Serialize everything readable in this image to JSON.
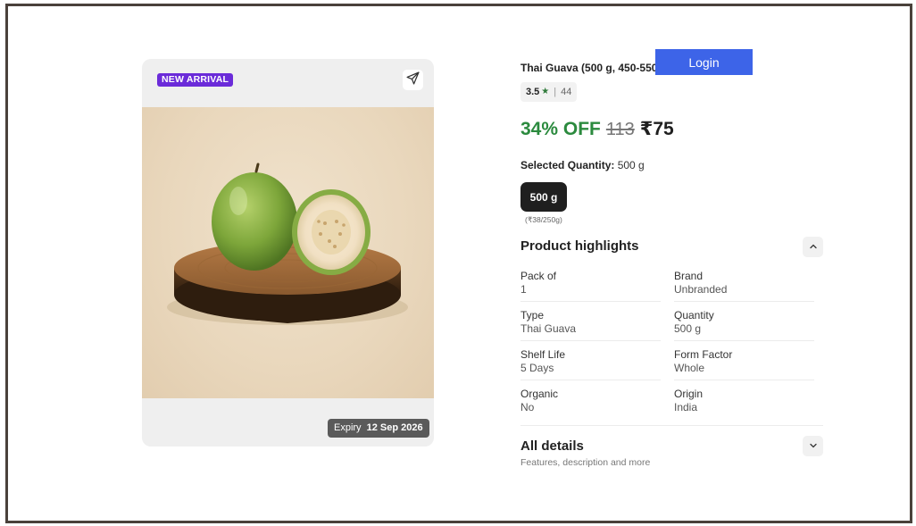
{
  "media": {
    "badge": "NEW ARRIVAL",
    "expiry_label": "Expiry",
    "expiry_date": "12 Sep 2026"
  },
  "product": {
    "title": "Thai Guava (500 g, 450-550",
    "rating": "3.5",
    "rating_count": "44",
    "discount": "34% OFF",
    "mrp": "113",
    "price": "₹75"
  },
  "auth": {
    "login_label": "Login"
  },
  "quantity": {
    "selected_label": "Selected Quantity:",
    "selected_value": "500 g",
    "chip_label": "500 g",
    "chip_unit_price": "(₹38/250g)"
  },
  "highlights": {
    "title": "Product highlights",
    "items": [
      {
        "label": "Pack of",
        "value": "1"
      },
      {
        "label": "Brand",
        "value": "Unbranded"
      },
      {
        "label": "Type",
        "value": "Thai Guava"
      },
      {
        "label": "Quantity",
        "value": "500 g"
      },
      {
        "label": "Shelf Life",
        "value": "5 Days"
      },
      {
        "label": "Form Factor",
        "value": "Whole"
      },
      {
        "label": "Organic",
        "value": "No"
      },
      {
        "label": "Origin",
        "value": "India"
      }
    ]
  },
  "all_details": {
    "title": "All details",
    "subtitle": "Features, description and more"
  },
  "colors": {
    "badge": "#6b2bd9",
    "login": "#3d64e8",
    "discount": "#2b8a3e",
    "frame": "#4a413b"
  }
}
